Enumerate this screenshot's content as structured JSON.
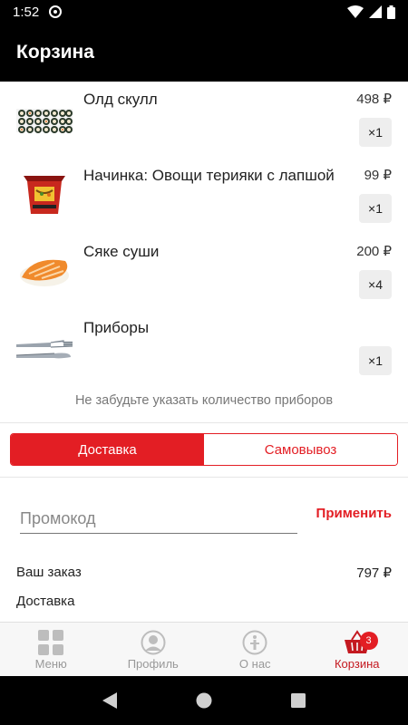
{
  "status": {
    "time": "1:52"
  },
  "header": {
    "title": "Корзина"
  },
  "items": [
    {
      "name": "Олд скулл",
      "price": "498 ₽",
      "qty": "×1",
      "icon": "sushi-set-image"
    },
    {
      "name": "Начинка: Овощи терияки с лапшой",
      "price": "99 ₽",
      "qty": "×1",
      "icon": "noodle-box-image"
    },
    {
      "name": "Сяке суши",
      "price": "200 ₽",
      "qty": "×4",
      "icon": "salmon-nigiri-image"
    },
    {
      "name": "Приборы",
      "price": "",
      "qty": "×1",
      "icon": "cutlery-image"
    }
  ],
  "hint": "Не забудьте указать количество приборов",
  "delivery_toggle": {
    "delivery": "Доставка",
    "pickup": "Самовывоз"
  },
  "promo": {
    "placeholder": "Промокод",
    "value": "",
    "apply": "Применить"
  },
  "summary": {
    "order_label": "Ваш заказ",
    "order_value": "797 ₽",
    "delivery_label": "Доставка"
  },
  "nav": {
    "menu": "Меню",
    "profile": "Профиль",
    "about": "О нас",
    "cart": "Корзина",
    "cart_badge": "3"
  },
  "colors": {
    "accent": "#e31e24",
    "header": "#000000"
  }
}
